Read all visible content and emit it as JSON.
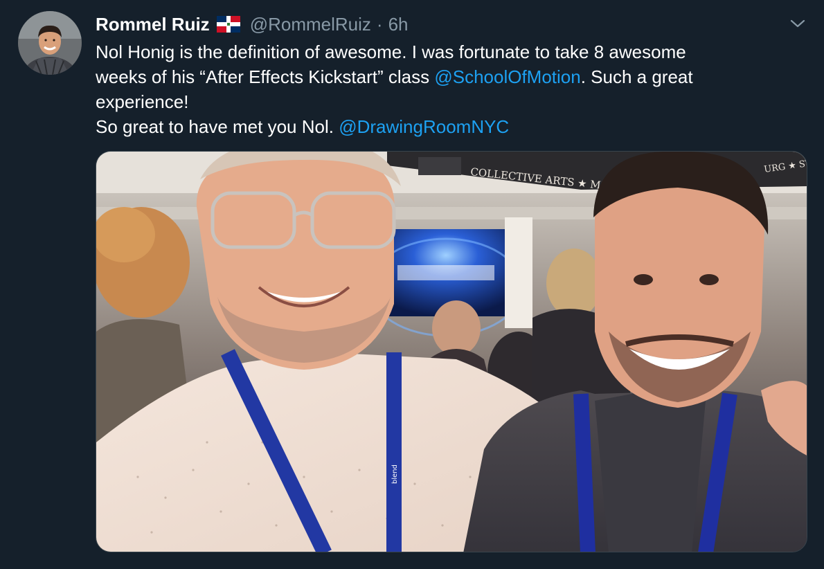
{
  "tweet": {
    "author": {
      "display_name": "Rommel Ruiz",
      "flag_icon": "dominican-republic-flag-icon",
      "handle": "@RommelRuiz",
      "separator": "·",
      "time": "6h"
    },
    "menu_icon": "chevron-down-icon",
    "text": {
      "line1": "Nol Honig is the definition of awesome. I was fortunate to take 8 awesome",
      "line2_before": "weeks of his “After Effects Kickstart” class ",
      "line2_mention": "@SchoolOfMotion",
      "line2_after": ". Such a great",
      "line3": "experience!",
      "line4_before": "So great to have met you Nol. ",
      "line4_mention": "@DrawingRoomNYC"
    },
    "photo": {
      "sign_text": "COLLECTIVE ARTS ★ MARINER",
      "sign_text_right": "URG ★ ST",
      "lanyard_text": "blend"
    },
    "colors": {
      "background": "#15202b",
      "link": "#1da1f2",
      "secondary_text": "#8899a6"
    }
  }
}
